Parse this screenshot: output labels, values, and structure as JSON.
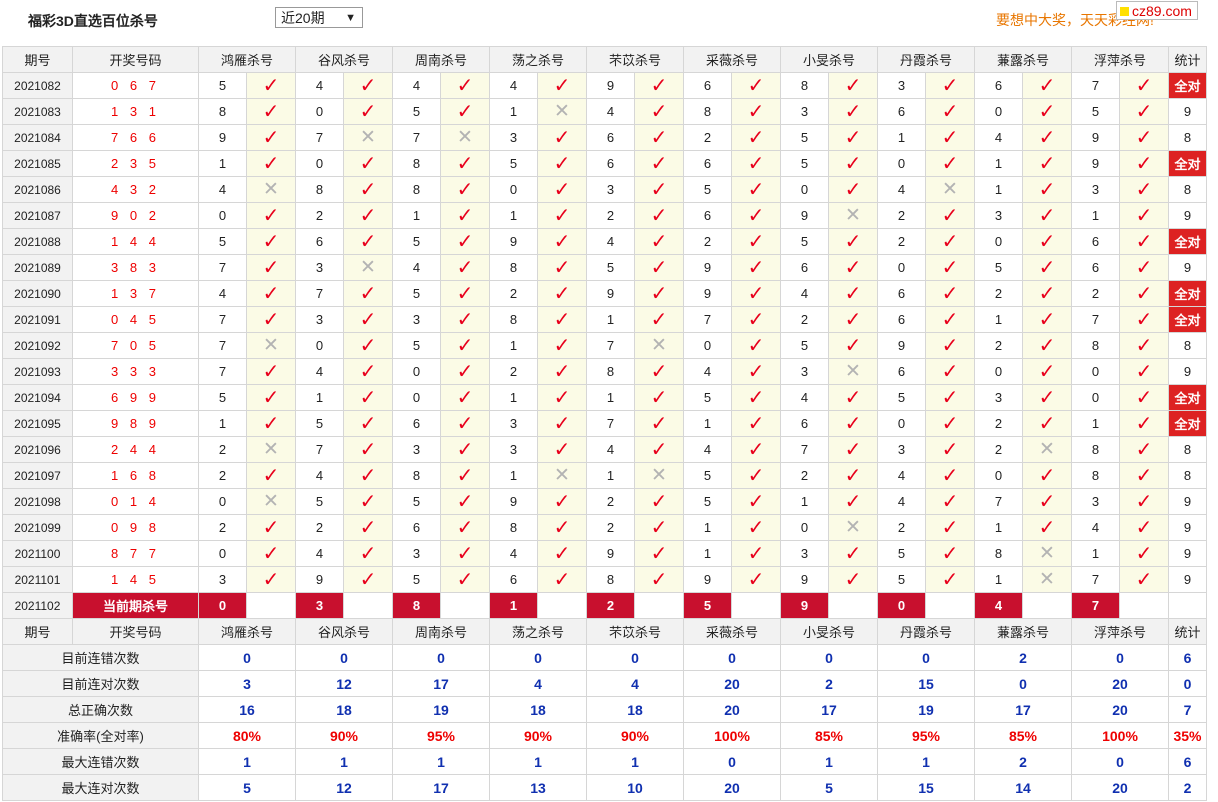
{
  "header": {
    "title": "福彩3D直选百位杀号",
    "period_select": "近20期",
    "ad_text": "要想中大奖，天天彩经网!",
    "logo": "cz89.com"
  },
  "columns": {
    "issue": "期号",
    "number": "开奖号码",
    "experts": [
      "鸿雁杀号",
      "谷风杀号",
      "周南杀号",
      "荡之杀号",
      "芣苡杀号",
      "采薇杀号",
      "小旻杀号",
      "丹霞杀号",
      "蒹露杀号",
      "浮萍杀号"
    ],
    "stat": "统计"
  },
  "rows": [
    {
      "issue": "2021082",
      "number": "0 6 7",
      "kills": [
        "5",
        "4",
        "4",
        "4",
        "9",
        "6",
        "8",
        "3",
        "6",
        "7"
      ],
      "ok": [
        1,
        1,
        1,
        1,
        1,
        1,
        1,
        1,
        1,
        1
      ],
      "stat": "全对"
    },
    {
      "issue": "2021083",
      "number": "1 3 1",
      "kills": [
        "8",
        "0",
        "5",
        "1",
        "4",
        "8",
        "3",
        "6",
        "0",
        "5"
      ],
      "ok": [
        1,
        1,
        1,
        0,
        1,
        1,
        1,
        1,
        1,
        1
      ],
      "stat": "9"
    },
    {
      "issue": "2021084",
      "number": "7 6 6",
      "kills": [
        "9",
        "7",
        "7",
        "3",
        "6",
        "2",
        "5",
        "1",
        "4",
        "9"
      ],
      "ok": [
        1,
        0,
        0,
        1,
        1,
        1,
        1,
        1,
        1,
        1
      ],
      "stat": "8"
    },
    {
      "issue": "2021085",
      "number": "2 3 5",
      "kills": [
        "1",
        "0",
        "8",
        "5",
        "6",
        "6",
        "5",
        "0",
        "1",
        "9"
      ],
      "ok": [
        1,
        1,
        1,
        1,
        1,
        1,
        1,
        1,
        1,
        1
      ],
      "stat": "全对"
    },
    {
      "issue": "2021086",
      "number": "4 3 2",
      "kills": [
        "4",
        "8",
        "8",
        "0",
        "3",
        "5",
        "0",
        "4",
        "1",
        "3"
      ],
      "ok": [
        0,
        1,
        1,
        1,
        1,
        1,
        1,
        0,
        1,
        1
      ],
      "stat": "8"
    },
    {
      "issue": "2021087",
      "number": "9 0 2",
      "kills": [
        "0",
        "2",
        "1",
        "1",
        "2",
        "6",
        "9",
        "2",
        "3",
        "1"
      ],
      "ok": [
        1,
        1,
        1,
        1,
        1,
        1,
        0,
        1,
        1,
        1
      ],
      "stat": "9"
    },
    {
      "issue": "2021088",
      "number": "1 4 4",
      "kills": [
        "5",
        "6",
        "5",
        "9",
        "4",
        "2",
        "5",
        "2",
        "0",
        "6"
      ],
      "ok": [
        1,
        1,
        1,
        1,
        1,
        1,
        1,
        1,
        1,
        1
      ],
      "stat": "全对"
    },
    {
      "issue": "2021089",
      "number": "3 8 3",
      "kills": [
        "7",
        "3",
        "4",
        "8",
        "5",
        "9",
        "6",
        "0",
        "5",
        "6"
      ],
      "ok": [
        1,
        0,
        1,
        1,
        1,
        1,
        1,
        1,
        1,
        1
      ],
      "stat": "9"
    },
    {
      "issue": "2021090",
      "number": "1 3 7",
      "kills": [
        "4",
        "7",
        "5",
        "2",
        "9",
        "9",
        "4",
        "6",
        "2",
        "2"
      ],
      "ok": [
        1,
        1,
        1,
        1,
        1,
        1,
        1,
        1,
        1,
        1
      ],
      "stat": "全对"
    },
    {
      "issue": "2021091",
      "number": "0 4 5",
      "kills": [
        "7",
        "3",
        "3",
        "8",
        "1",
        "7",
        "2",
        "6",
        "1",
        "7"
      ],
      "ok": [
        1,
        1,
        1,
        1,
        1,
        1,
        1,
        1,
        1,
        1
      ],
      "stat": "全对"
    },
    {
      "issue": "2021092",
      "number": "7 0 5",
      "kills": [
        "7",
        "0",
        "5",
        "1",
        "7",
        "0",
        "5",
        "9",
        "2",
        "8"
      ],
      "ok": [
        0,
        1,
        1,
        1,
        0,
        1,
        1,
        1,
        1,
        1
      ],
      "stat": "8"
    },
    {
      "issue": "2021093",
      "number": "3 3 3",
      "kills": [
        "7",
        "4",
        "0",
        "2",
        "8",
        "4",
        "3",
        "6",
        "0",
        "0"
      ],
      "ok": [
        1,
        1,
        1,
        1,
        1,
        1,
        0,
        1,
        1,
        1
      ],
      "stat": "9"
    },
    {
      "issue": "2021094",
      "number": "6 9 9",
      "kills": [
        "5",
        "1",
        "0",
        "1",
        "1",
        "5",
        "4",
        "5",
        "3",
        "0"
      ],
      "ok": [
        1,
        1,
        1,
        1,
        1,
        1,
        1,
        1,
        1,
        1
      ],
      "stat": "全对"
    },
    {
      "issue": "2021095",
      "number": "9 8 9",
      "kills": [
        "1",
        "5",
        "6",
        "3",
        "7",
        "1",
        "6",
        "0",
        "2",
        "1"
      ],
      "ok": [
        1,
        1,
        1,
        1,
        1,
        1,
        1,
        1,
        1,
        1
      ],
      "stat": "全对"
    },
    {
      "issue": "2021096",
      "number": "2 4 4",
      "kills": [
        "2",
        "7",
        "3",
        "3",
        "4",
        "4",
        "7",
        "3",
        "2",
        "8"
      ],
      "ok": [
        0,
        1,
        1,
        1,
        1,
        1,
        1,
        1,
        0,
        1
      ],
      "stat": "8"
    },
    {
      "issue": "2021097",
      "number": "1 6 8",
      "kills": [
        "2",
        "4",
        "8",
        "1",
        "1",
        "5",
        "2",
        "4",
        "0",
        "8"
      ],
      "ok": [
        1,
        1,
        1,
        0,
        0,
        1,
        1,
        1,
        1,
        1
      ],
      "stat": "8"
    },
    {
      "issue": "2021098",
      "number": "0 1 4",
      "kills": [
        "0",
        "5",
        "5",
        "9",
        "2",
        "5",
        "1",
        "4",
        "7",
        "3"
      ],
      "ok": [
        0,
        1,
        1,
        1,
        1,
        1,
        1,
        1,
        1,
        1
      ],
      "stat": "9"
    },
    {
      "issue": "2021099",
      "number": "0 9 8",
      "kills": [
        "2",
        "2",
        "6",
        "8",
        "2",
        "1",
        "0",
        "2",
        "1",
        "4"
      ],
      "ok": [
        1,
        1,
        1,
        1,
        1,
        1,
        0,
        1,
        1,
        1
      ],
      "stat": "9"
    },
    {
      "issue": "2021100",
      "number": "8 7 7",
      "kills": [
        "0",
        "4",
        "3",
        "4",
        "9",
        "1",
        "3",
        "5",
        "8",
        "1"
      ],
      "ok": [
        1,
        1,
        1,
        1,
        1,
        1,
        1,
        1,
        0,
        1
      ],
      "stat": "9"
    },
    {
      "issue": "2021101",
      "number": "1 4 5",
      "kills": [
        "3",
        "9",
        "5",
        "6",
        "8",
        "9",
        "9",
        "5",
        "1",
        "7"
      ],
      "ok": [
        1,
        1,
        1,
        1,
        1,
        1,
        1,
        1,
        0,
        1
      ],
      "stat": "9"
    }
  ],
  "current": {
    "issue": "2021102",
    "label": "当前期杀号",
    "kills": [
      "0",
      "3",
      "8",
      "1",
      "2",
      "5",
      "9",
      "0",
      "4",
      "7"
    ]
  },
  "stats": [
    {
      "label": "目前连错次数",
      "values": [
        "0",
        "0",
        "0",
        "0",
        "0",
        "0",
        "0",
        "0",
        "2",
        "0"
      ],
      "total": "6",
      "color": "blue"
    },
    {
      "label": "目前连对次数",
      "values": [
        "3",
        "12",
        "17",
        "4",
        "4",
        "20",
        "2",
        "15",
        "0",
        "20"
      ],
      "total": "0",
      "color": "blue"
    },
    {
      "label": "总正确次数",
      "values": [
        "16",
        "18",
        "19",
        "18",
        "18",
        "20",
        "17",
        "19",
        "17",
        "20"
      ],
      "total": "7",
      "color": "blue"
    },
    {
      "label": "准确率(全对率)",
      "values": [
        "80%",
        "90%",
        "95%",
        "90%",
        "90%",
        "100%",
        "85%",
        "95%",
        "85%",
        "100%"
      ],
      "total": "35%",
      "color": "red"
    },
    {
      "label": "最大连错次数",
      "values": [
        "1",
        "1",
        "1",
        "1",
        "1",
        "0",
        "1",
        "1",
        "2",
        "0"
      ],
      "total": "6",
      "color": "blue"
    },
    {
      "label": "最大连对次数",
      "values": [
        "5",
        "12",
        "17",
        "13",
        "10",
        "20",
        "5",
        "15",
        "14",
        "20"
      ],
      "total": "2",
      "color": "blue"
    }
  ],
  "icons": {
    "check": "check-icon",
    "cross": "cross-icon"
  },
  "colors": {
    "accent_red": "#c8102e",
    "check_red": "#e8001c",
    "stat_blue": "#1030b0"
  }
}
